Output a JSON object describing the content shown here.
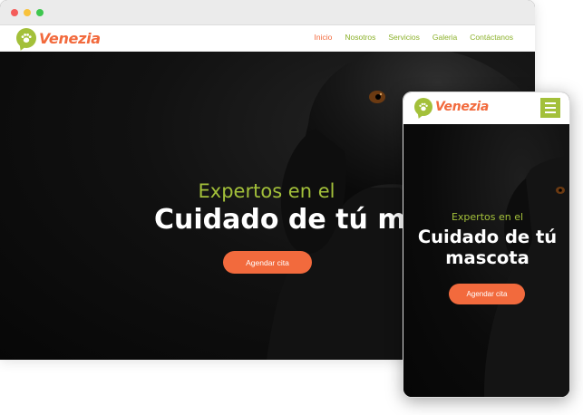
{
  "brand": {
    "name": "Venezia",
    "primary_color": "#a3c03a",
    "accent_color": "#f26a3d"
  },
  "desktop": {
    "nav": {
      "items": [
        "Inicio",
        "Nosotros",
        "Servicios",
        "Galeria",
        "Contáctanos"
      ],
      "active": "Inicio"
    },
    "hero": {
      "subtitle": "Expertos en el",
      "title": "Cuidado de tú mascota",
      "cta_label": "Agendar cita"
    }
  },
  "mobile": {
    "hero": {
      "subtitle": "Expertos en el",
      "title": "Cuidado de tú mascota",
      "cta_label": "Agendar cita"
    }
  },
  "icons": {
    "logo": "paw-icon",
    "window_controls": [
      "close-dot",
      "minimize-dot",
      "maximize-dot"
    ],
    "menu": "hamburger-icon"
  }
}
